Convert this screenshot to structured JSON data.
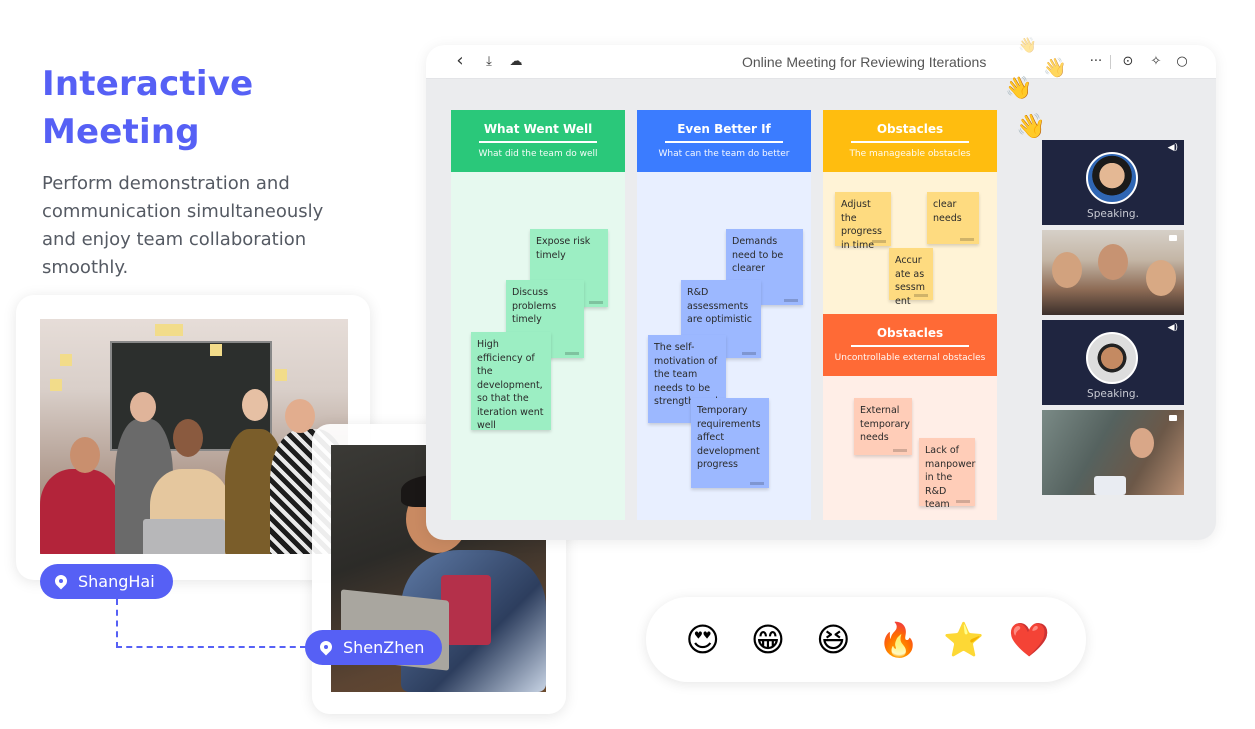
{
  "hero": {
    "title_line1": "Interactive",
    "title_line2": "Meeting",
    "description": "Perform demonstration and communication simultaneously and enjoy team collaboration smoothly."
  },
  "locations": [
    {
      "label": "ShangHai",
      "icon": "location-pin-icon"
    },
    {
      "label": "ShenZhen",
      "icon": "location-pin-icon"
    }
  ],
  "app": {
    "title": "Online Meeting for Reviewing Iterations",
    "toolbar_left": [
      {
        "icon": "back-icon",
        "glyph": "‹"
      },
      {
        "icon": "download-icon",
        "glyph": "⤓"
      },
      {
        "icon": "cloud-sync-icon",
        "glyph": "☁"
      }
    ],
    "toolbar_right": [
      {
        "icon": "more-icon",
        "glyph": "···"
      },
      {
        "icon": "record-icon",
        "glyph": "⊙"
      },
      {
        "icon": "celebrate-icon",
        "glyph": "✧"
      },
      {
        "icon": "chat-icon",
        "glyph": "○"
      }
    ],
    "columns": [
      {
        "title": "What Went Well",
        "subtitle": "What did the team do well",
        "color": "#2ac87a",
        "body_color": "#e6f9ef",
        "notes": [
          "Expose risk timely",
          "Discuss problems timely",
          "High efficiency of the development, so that the iteration went well"
        ]
      },
      {
        "title": "Even Better If",
        "subtitle": "What can the team do better",
        "color": "#3b7cff",
        "body_color": "#e8efff",
        "notes": [
          "Demands need to be clearer",
          "R&D assessments are optimistic",
          "The self-motivation of the team needs to be strengthened",
          "Temporary requirements affect development progress"
        ]
      },
      {
        "title": "Obstacles",
        "subtitle": "The manageable obstacles",
        "color": "#ffbd0f",
        "body_color": "#fff3d6",
        "notes": [
          "Adjust the progress in time",
          "clear needs",
          "Accurate assessment"
        ]
      },
      {
        "title": "Obstacles",
        "subtitle": "Uncontrollable external obstacles",
        "color": "#ff6a36",
        "body_color": "#ffeee7",
        "notes": [
          "External temporary needs",
          "Lack of manpower in the R&D team"
        ]
      }
    ],
    "video_tiles": [
      {
        "status": "Speaking.",
        "type": "avatar",
        "audio_icon": "speaker-icon"
      },
      {
        "status": "",
        "type": "video",
        "audio_icon": "camera-icon"
      },
      {
        "status": "Speaking.",
        "type": "avatar",
        "audio_icon": "speaker-icon"
      },
      {
        "status": "",
        "type": "video",
        "audio_icon": "camera-icon"
      }
    ]
  },
  "reactions": [
    {
      "name": "heart-eyes",
      "glyph": "😍"
    },
    {
      "name": "grin",
      "glyph": "😁"
    },
    {
      "name": "tears-of-joy",
      "glyph": "😆"
    },
    {
      "name": "fire",
      "glyph": "🔥"
    },
    {
      "name": "star",
      "glyph": "⭐"
    },
    {
      "name": "heart",
      "glyph": "❤️"
    }
  ],
  "waving_hands": "👋",
  "colors": {
    "brand": "#5660f5",
    "app_bg": "#ebecee"
  }
}
